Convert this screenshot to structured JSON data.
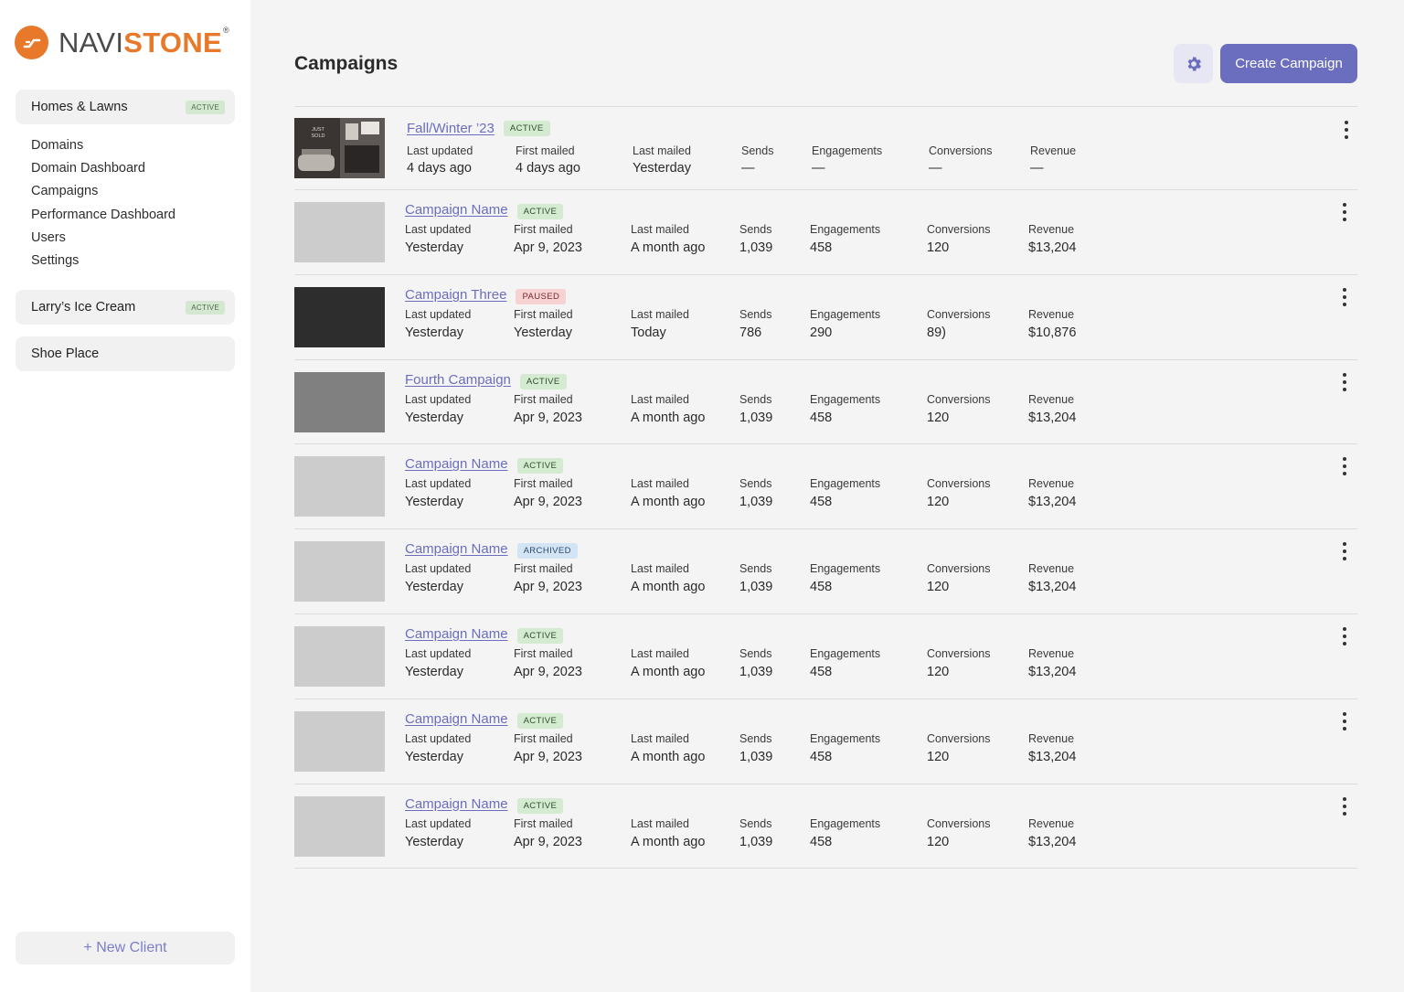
{
  "brand": {
    "navi": "NAVI",
    "stone": "STONE",
    "reg": "®",
    "accent": "#e8792a"
  },
  "sidebar": {
    "clients": [
      {
        "name": "Homes & Lawns",
        "badge": "ACTIVE"
      },
      {
        "name": "Larry’s Ice Cream",
        "badge": "ACTIVE"
      },
      {
        "name": "Shoe Place",
        "badge": ""
      }
    ],
    "nav": [
      "Domains",
      "Domain Dashboard",
      "Campaigns",
      "Performance Dashboard",
      "Users",
      "Settings"
    ],
    "new_client": "+ New Client"
  },
  "header": {
    "title": "Campaigns",
    "settings_icon": "gear-icon",
    "create_label": "Create Campaign",
    "primary_color": "#6b6ebe"
  },
  "columns": {
    "last_updated": "Last updated",
    "first_mailed": "First mailed",
    "last_mailed": "Last mailed",
    "sends": "Sends",
    "engagements": "Engagements",
    "conversions": "Conversions",
    "revenue": "Revenue"
  },
  "thumb_text": {
    "line1": "JUST",
    "line2": "SOLD"
  },
  "campaigns": [
    {
      "name": "Fall/Winter ’23",
      "status": "ACTIVE",
      "last_updated": "4 days ago",
      "first_mailed": "4 days ago",
      "last_mailed": "Yesterday",
      "sends": "—",
      "engagements": "—",
      "conversions": "—",
      "revenue": "—"
    },
    {
      "name": "Campaign Name",
      "status": "ACTIVE",
      "last_updated": "Yesterday",
      "first_mailed": "Apr 9, 2023",
      "last_mailed": "A month ago",
      "sends": "1,039",
      "engagements": "458",
      "conversions": "120",
      "revenue": "$13,204"
    },
    {
      "name": "Campaign Three",
      "status": "PAUSED",
      "last_updated": "Yesterday",
      "first_mailed": "Yesterday",
      "last_mailed": "Today",
      "sends": "786",
      "engagements": "290",
      "conversions": "89)",
      "revenue": "$10,876"
    },
    {
      "name": "Fourth Campaign",
      "status": "ACTIVE",
      "last_updated": "Yesterday",
      "first_mailed": "Apr 9, 2023",
      "last_mailed": "A month ago",
      "sends": "1,039",
      "engagements": "458",
      "conversions": "120",
      "revenue": "$13,204"
    },
    {
      "name": "Campaign Name",
      "status": "ACTIVE",
      "last_updated": "Yesterday",
      "first_mailed": "Apr 9, 2023",
      "last_mailed": "A month ago",
      "sends": "1,039",
      "engagements": "458",
      "conversions": "120",
      "revenue": "$13,204"
    },
    {
      "name": "Campaign Name",
      "status": "ARCHIVED",
      "last_updated": "Yesterday",
      "first_mailed": "Apr 9, 2023",
      "last_mailed": "A month ago",
      "sends": "1,039",
      "engagements": "458",
      "conversions": "120",
      "revenue": "$13,204"
    },
    {
      "name": "Campaign Name",
      "status": "ACTIVE",
      "last_updated": "Yesterday",
      "first_mailed": "Apr 9, 2023",
      "last_mailed": "A month ago",
      "sends": "1,039",
      "engagements": "458",
      "conversions": "120",
      "revenue": "$13,204"
    },
    {
      "name": "Campaign Name",
      "status": "ACTIVE",
      "last_updated": "Yesterday",
      "first_mailed": "Apr 9, 2023",
      "last_mailed": "A month ago",
      "sends": "1,039",
      "engagements": "458",
      "conversions": "120",
      "revenue": "$13,204"
    },
    {
      "name": "Campaign Name",
      "status": "ACTIVE",
      "last_updated": "Yesterday",
      "first_mailed": "Apr 9, 2023",
      "last_mailed": "A month ago",
      "sends": "1,039",
      "engagements": "458",
      "conversions": "120",
      "revenue": "$13,204"
    }
  ],
  "thumbnails": [
    "photo",
    "#cccccc",
    "#2d2d2d",
    "#808080",
    "#cccccc",
    "#cccccc",
    "#cccccc",
    "#cccccc",
    "#cccccc"
  ]
}
